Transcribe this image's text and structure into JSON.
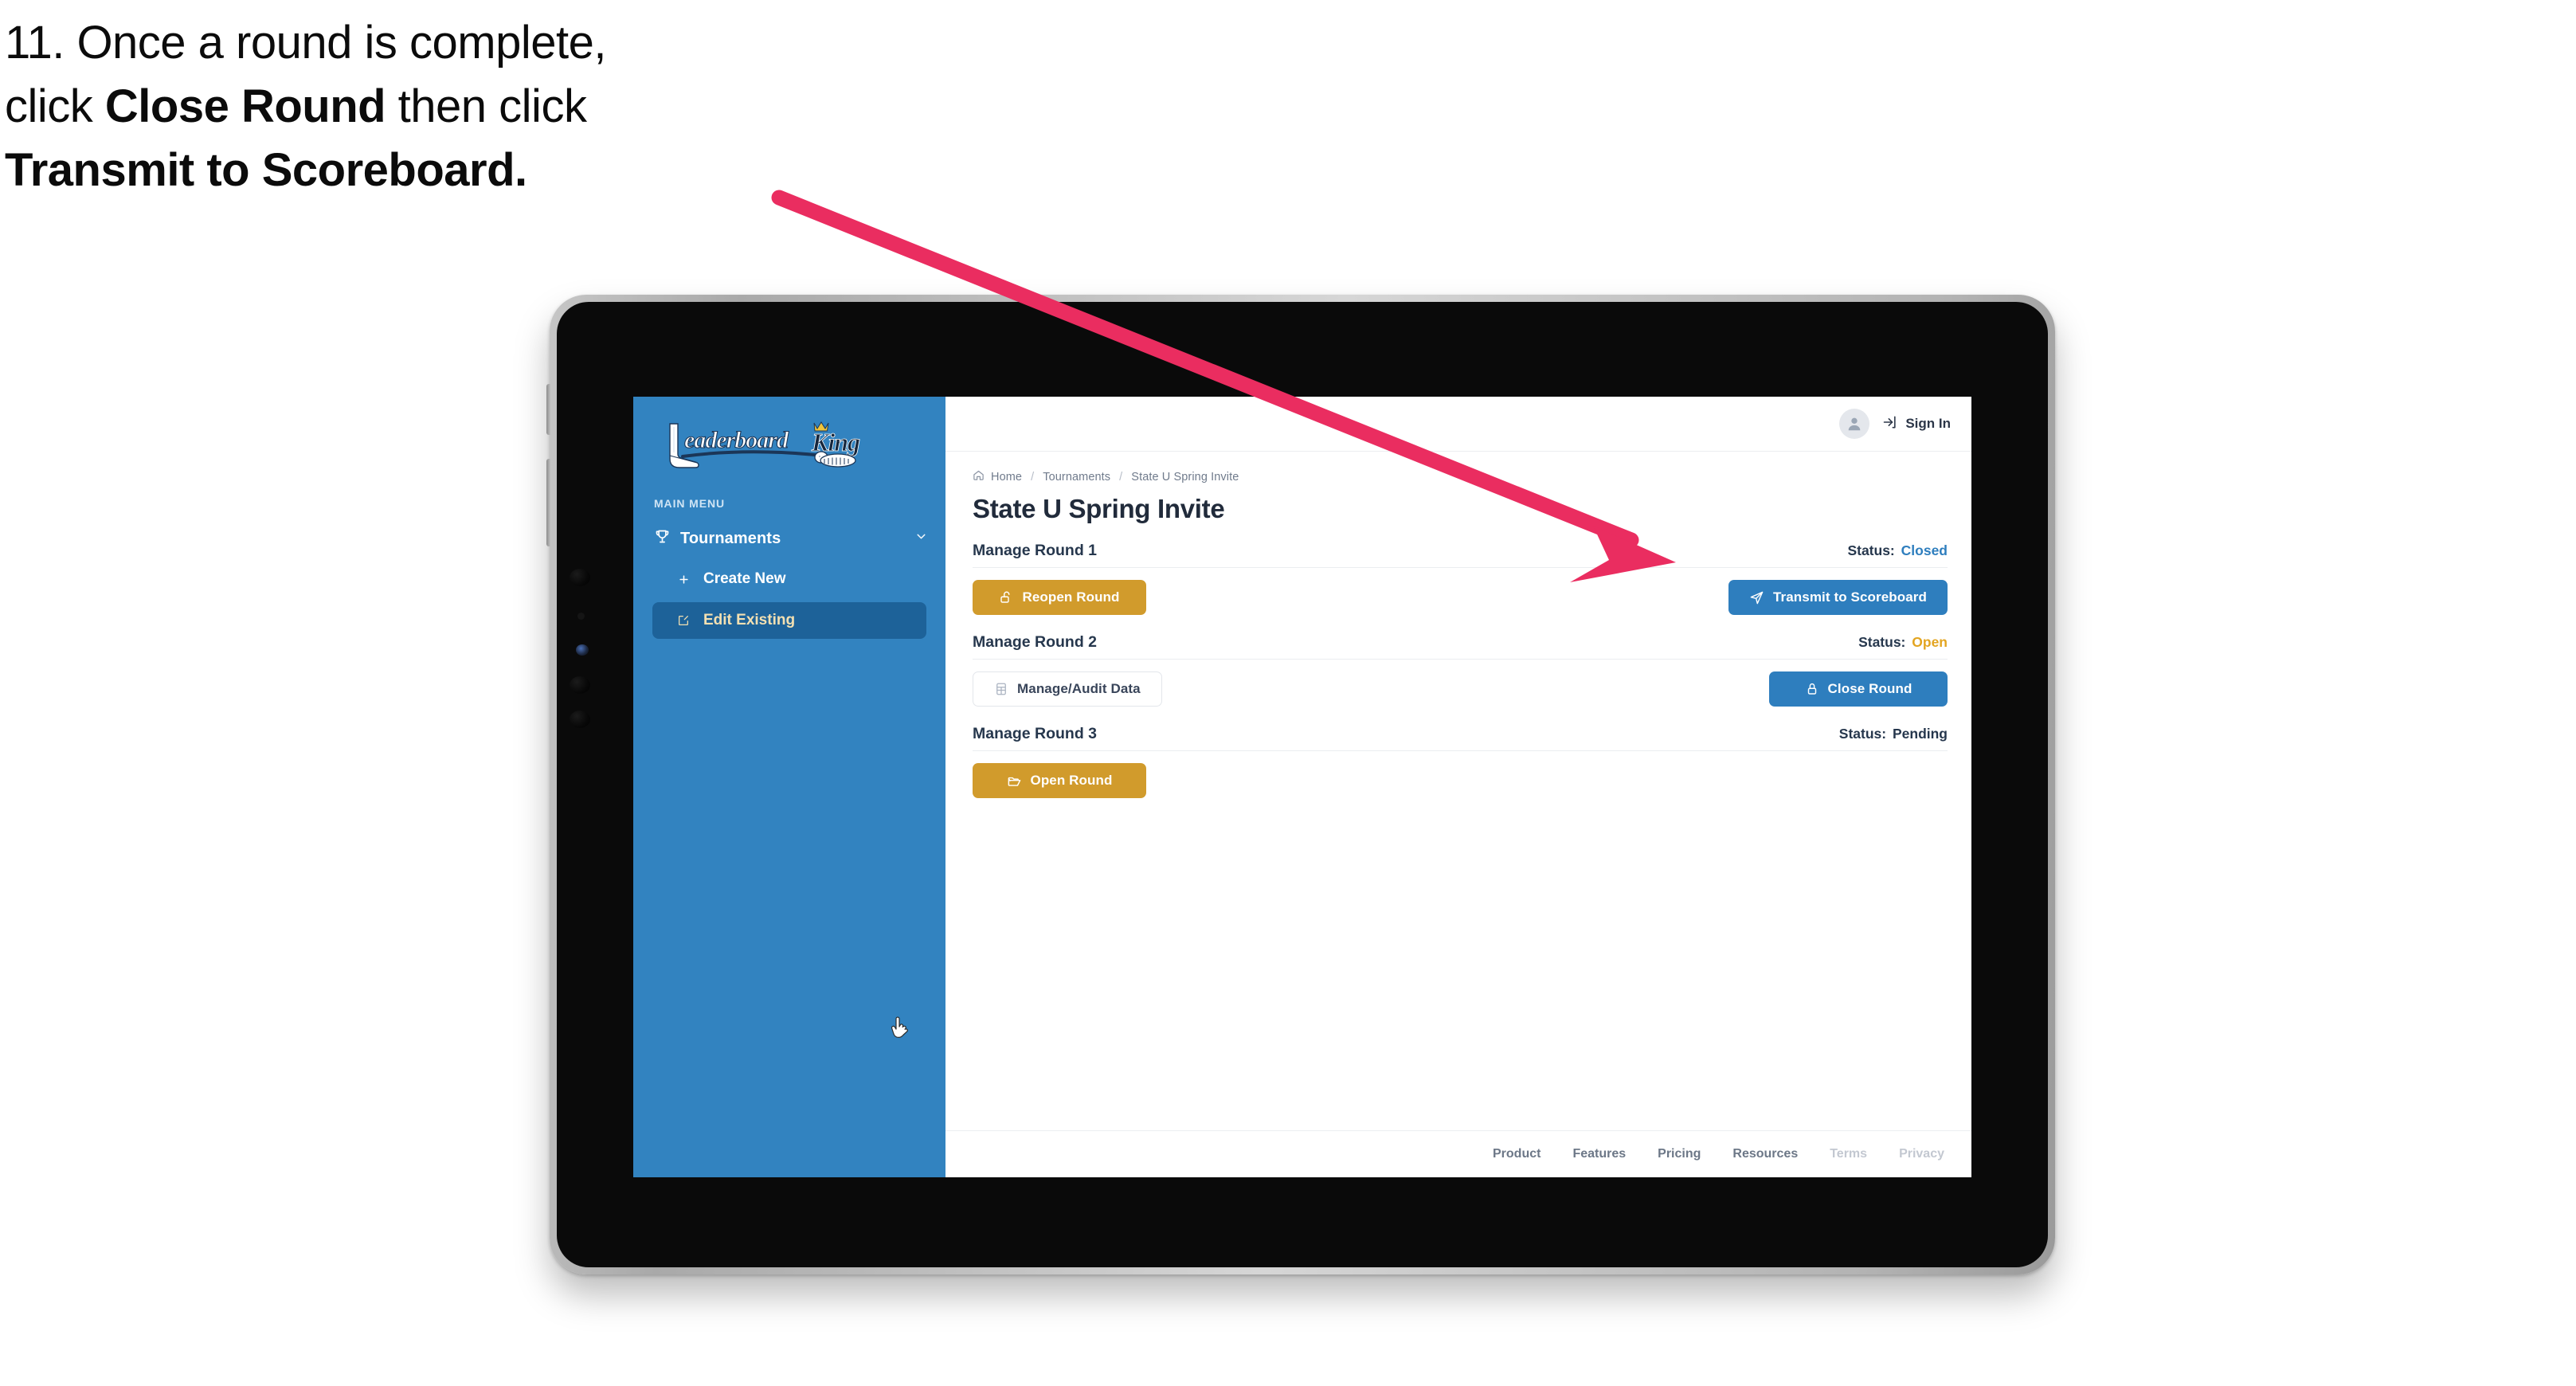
{
  "caption": {
    "number": "11.",
    "line1_a": "11. Once a round is complete,",
    "line2_a": "click ",
    "line2_b": "Close Round",
    "line2_c": " then click",
    "line3_b": "Transmit to Scoreboard."
  },
  "annotation": {
    "arrow_color": "#ea2d60",
    "points_to": "transmit-to-scoreboard-button"
  },
  "app": {
    "sidebar": {
      "logo_text_primary": "Leaderboard",
      "logo_text_secondary": "King",
      "menu_label": "MAIN MENU",
      "nav": {
        "label": "Tournaments",
        "icon": "trophy-icon",
        "chevron": "chevron-down-icon"
      },
      "items": [
        {
          "label": "Create New",
          "icon": "plus-icon",
          "active": false
        },
        {
          "label": "Edit Existing",
          "icon": "edit-pencil-icon",
          "active": true
        }
      ],
      "bg_color": "#3283c0",
      "active_bg_color": "#1d6299",
      "active_text_color": "#f3e0b2"
    },
    "topbar": {
      "avatar_icon": "user-avatar-icon",
      "signin_icon": "sign-in-arrow-icon",
      "signin_label": "Sign In"
    },
    "breadcrumb": {
      "home_icon": "home-icon",
      "items": [
        "Home",
        "Tournaments",
        "State U Spring Invite"
      ],
      "separator": "/"
    },
    "page_title": "State U Spring Invite",
    "status_prefix": "Status:",
    "rounds": [
      {
        "name": "Manage Round 1",
        "status": "Closed",
        "status_class": "st-closed",
        "left_button": {
          "label": "Reopen Round",
          "icon": "unlock-icon",
          "style": "gold"
        },
        "right_button": {
          "label": "Transmit to Scoreboard",
          "icon": "paper-plane-icon",
          "style": "blue"
        }
      },
      {
        "name": "Manage Round 2",
        "status": "Open",
        "status_class": "st-open",
        "left_button": {
          "label": "Manage/Audit Data",
          "icon": "spreadsheet-icon",
          "style": "ghost"
        },
        "right_button": {
          "label": "Close Round",
          "icon": "lock-icon",
          "style": "blue"
        }
      },
      {
        "name": "Manage Round 3",
        "status": "Pending",
        "status_class": "st-pending",
        "left_button": {
          "label": "Open Round",
          "icon": "open-folder-icon",
          "style": "gold"
        },
        "right_button": null
      }
    ],
    "footer_links": [
      {
        "label": "Product",
        "dim": false
      },
      {
        "label": "Features",
        "dim": false
      },
      {
        "label": "Pricing",
        "dim": false
      },
      {
        "label": "Resources",
        "dim": false
      },
      {
        "label": "Terms",
        "dim": true
      },
      {
        "label": "Privacy",
        "dim": true
      }
    ],
    "colors": {
      "sidebar_blue": "#3283c0",
      "primary_blue": "#2e7ebe",
      "gold": "#d19b2c",
      "status_open": "#e3a521",
      "text_dark": "#26374d"
    }
  }
}
